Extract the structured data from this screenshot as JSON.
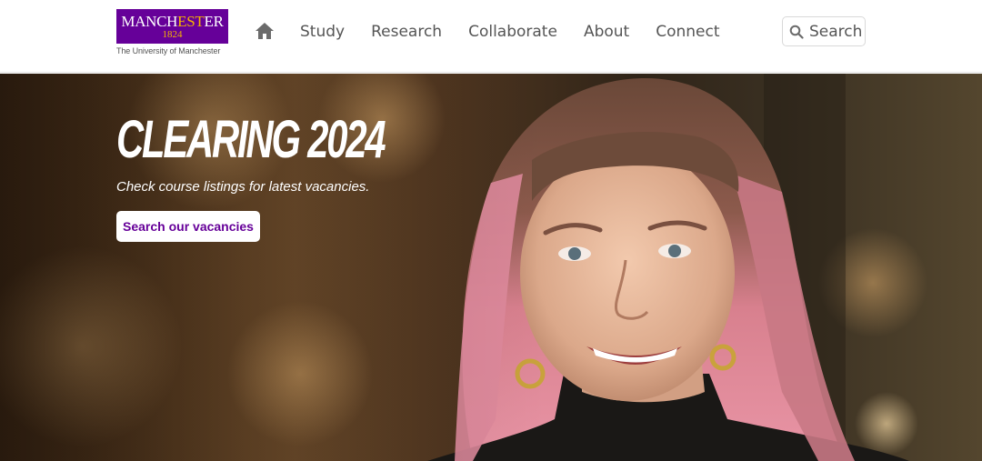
{
  "header": {
    "logo": {
      "word_part1": "MANCH",
      "word_part2": "EST",
      "word_part3": "ER",
      "year": "1824",
      "subtitle": "The University of Manchester"
    },
    "home_icon": "home-icon",
    "nav": [
      {
        "label": "Study"
      },
      {
        "label": "Research"
      },
      {
        "label": "Collaborate"
      },
      {
        "label": "About"
      },
      {
        "label": "Connect"
      }
    ],
    "search": {
      "label": "Search",
      "icon": "search-icon"
    }
  },
  "hero": {
    "title": "CLEARING 2024",
    "subtitle": "Check course listings for latest vacancies.",
    "button_label": "Search our vacancies"
  },
  "colors": {
    "brand_purple": "#660099",
    "brand_gold": "#f5b400",
    "nav_text": "#555555"
  }
}
